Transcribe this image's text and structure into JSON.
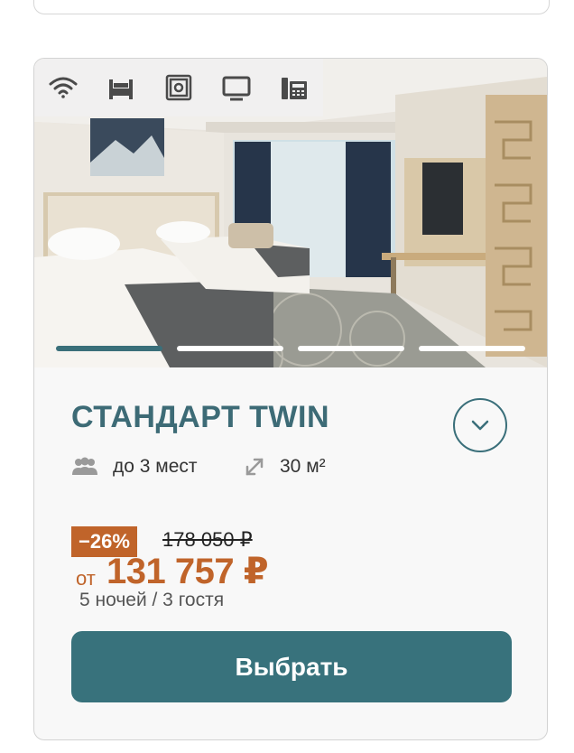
{
  "room": {
    "title": "СТАНДАРТ TWIN",
    "capacity": "до 3 мест",
    "area": "30 м²"
  },
  "amenities": [
    "wifi-icon",
    "bed-icon",
    "safe-icon",
    "tv-icon",
    "phone-icon"
  ],
  "gallery": {
    "slides": 4,
    "active": 1
  },
  "pricing": {
    "discount": "−26%",
    "old_price": "178 050 ₽",
    "prefix": "от",
    "price": "131 757 ₽",
    "stay": "5 ночей / 3 гостя"
  },
  "actions": {
    "select_label": "Выбрать"
  },
  "colors": {
    "accent": "#38727c",
    "title": "#3d6b76",
    "price": "#c0642a"
  }
}
